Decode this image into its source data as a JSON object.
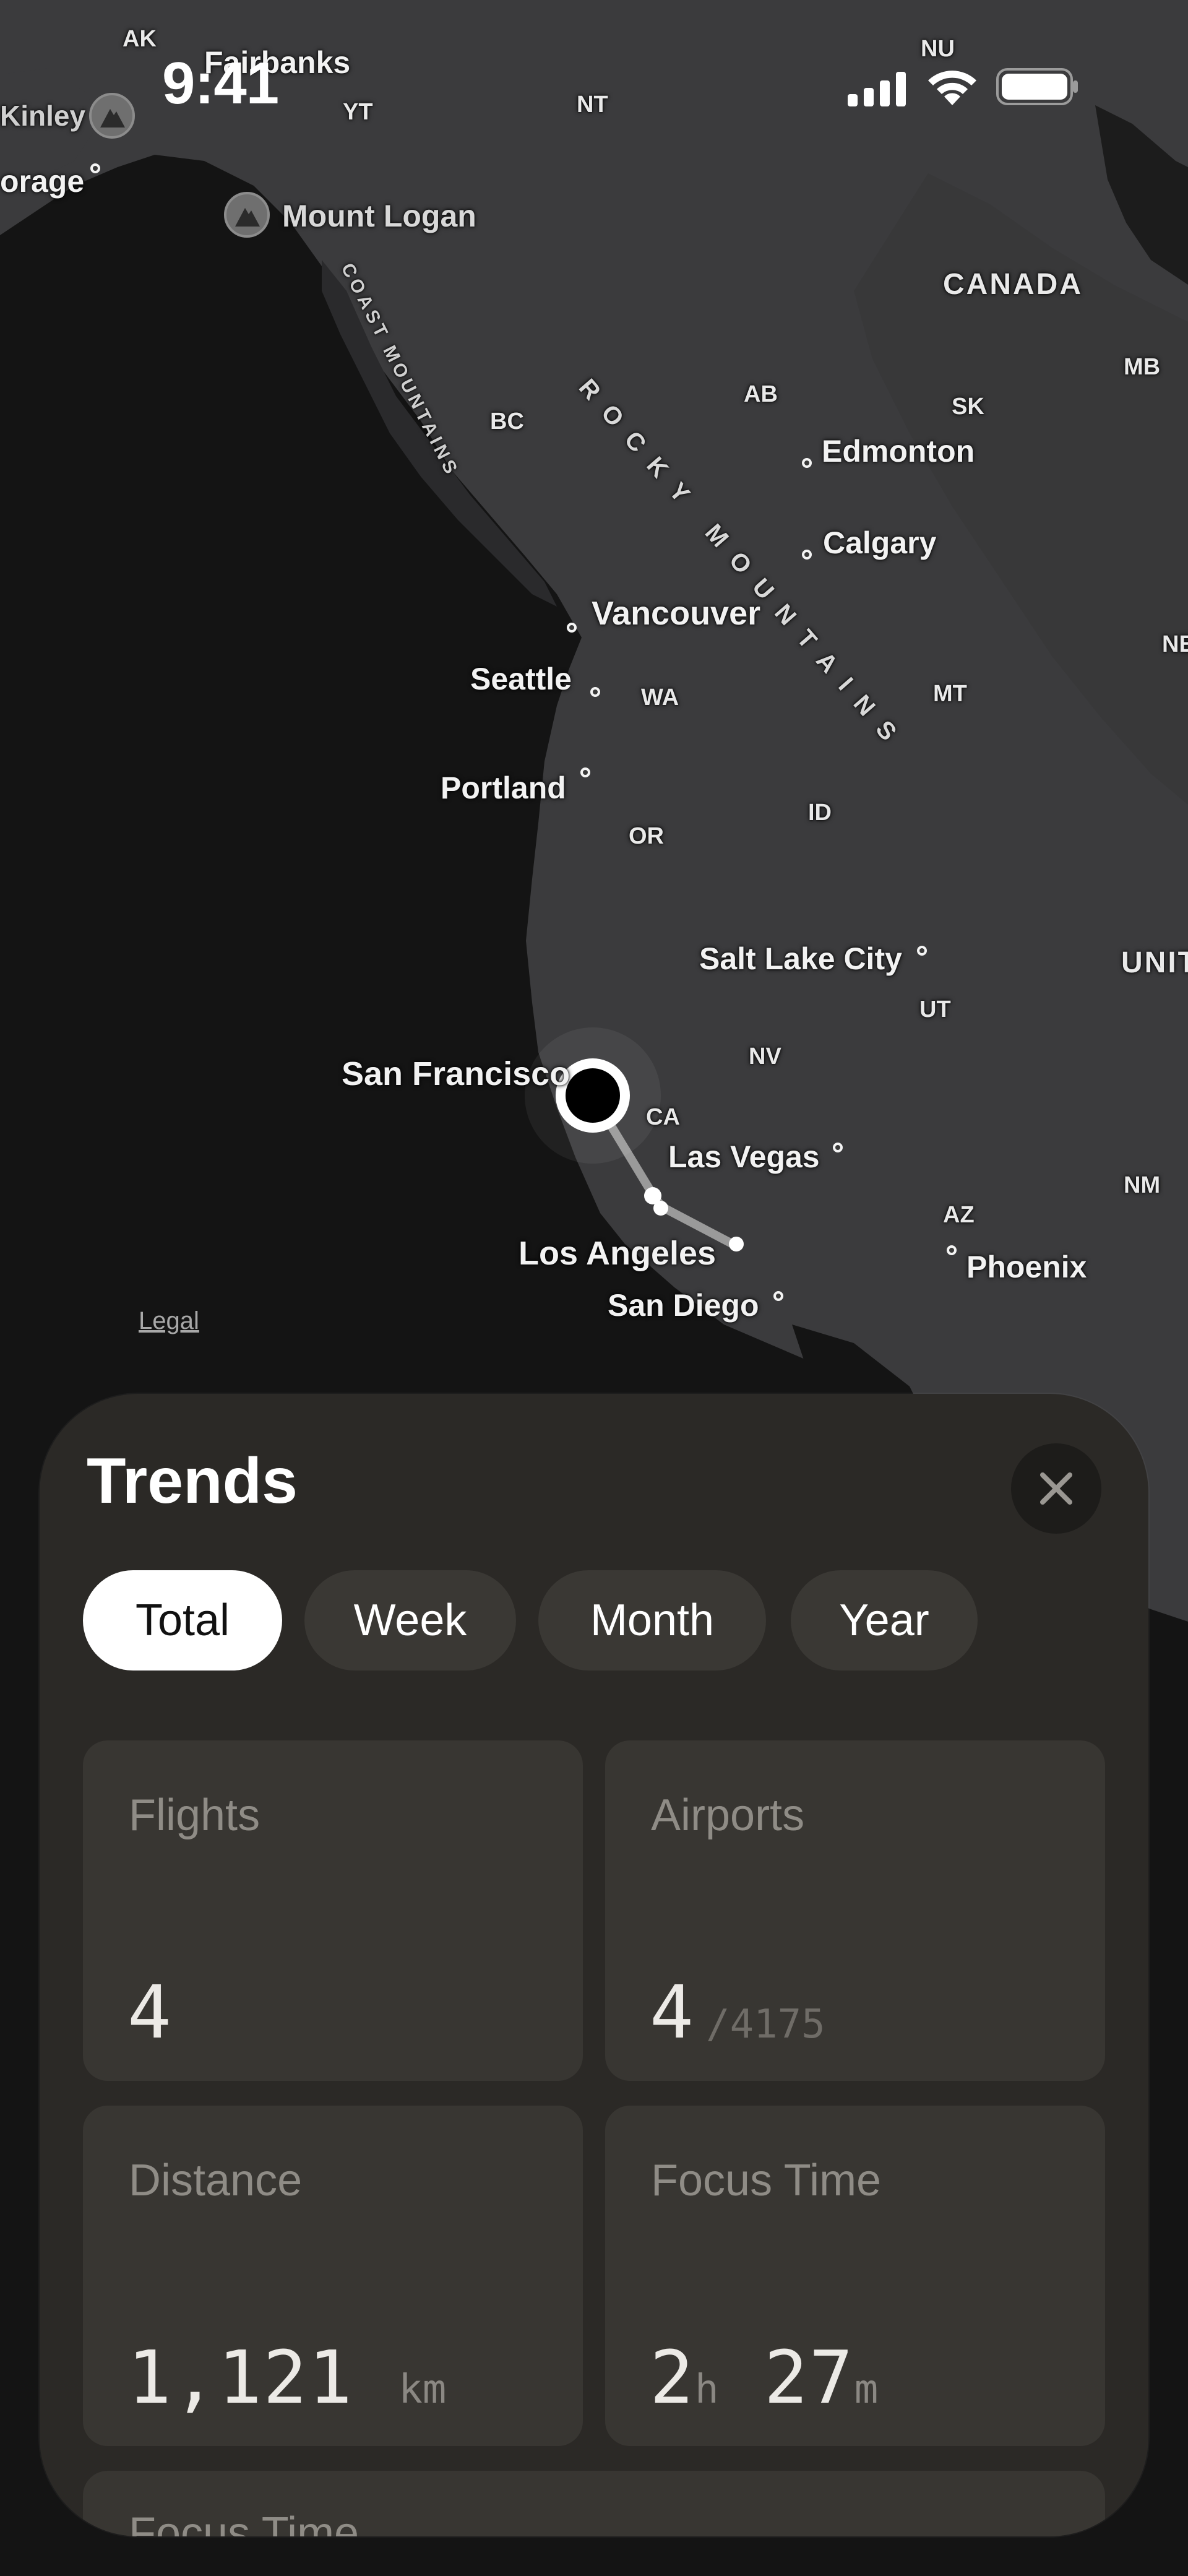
{
  "status_bar": {
    "time": "9:41"
  },
  "map": {
    "cities": {
      "fairbanks": "Fairbanks",
      "mckinley": "Kinley",
      "anchorage": "orage",
      "mount_logan": "Mount Logan",
      "edmonton": "Edmonton",
      "calgary": "Calgary",
      "vancouver": "Vancouver",
      "seattle": "Seattle",
      "portland": "Portland",
      "salt_lake_city": "Salt Lake City",
      "san_francisco": "San Francisco",
      "las_vegas": "Las Vegas",
      "los_angeles": "Los Angeles",
      "san_diego": "San Diego",
      "phoenix": "Phoenix"
    },
    "regions": {
      "ak": "AK",
      "yt": "YT",
      "nt": "NT",
      "nu": "NU",
      "bc": "BC",
      "ab": "AB",
      "sk": "SK",
      "mb": "MB",
      "wa": "WA",
      "or": "OR",
      "id": "ID",
      "mt": "MT",
      "nv": "NV",
      "ut": "UT",
      "ca": "CA",
      "az": "AZ",
      "nm": "NM",
      "ne": "NE"
    },
    "countries": {
      "canada": "CANADA",
      "united": "UNIT"
    },
    "ranges": {
      "rocky": "ROCKY MOUNTAINS",
      "coast": "COAST MOUNTAINS"
    },
    "legal": "Legal"
  },
  "sheet": {
    "title": "Trends",
    "close_icon": "xmark-icon",
    "segments": [
      "Total",
      "Week",
      "Month",
      "Year"
    ],
    "selected_segment": "Total",
    "cards": {
      "flights": {
        "label": "Flights",
        "value": "4"
      },
      "airports": {
        "label": "Airports",
        "value": "4",
        "sub": "/4175"
      },
      "distance": {
        "label": "Distance",
        "value": "1,121",
        "unit": "km"
      },
      "focus_time": {
        "label": "Focus Time",
        "hours": "2",
        "hours_unit": "h",
        "minutes": "27",
        "minutes_unit": "m"
      }
    },
    "peek_card": {
      "label": "Focus Time"
    }
  },
  "colors": {
    "map_land": "#3b3b3d",
    "map_water": "#141414",
    "sheet_bg": "#2b2926",
    "card_bg": "#383632",
    "segment_active": "#ffffff"
  }
}
